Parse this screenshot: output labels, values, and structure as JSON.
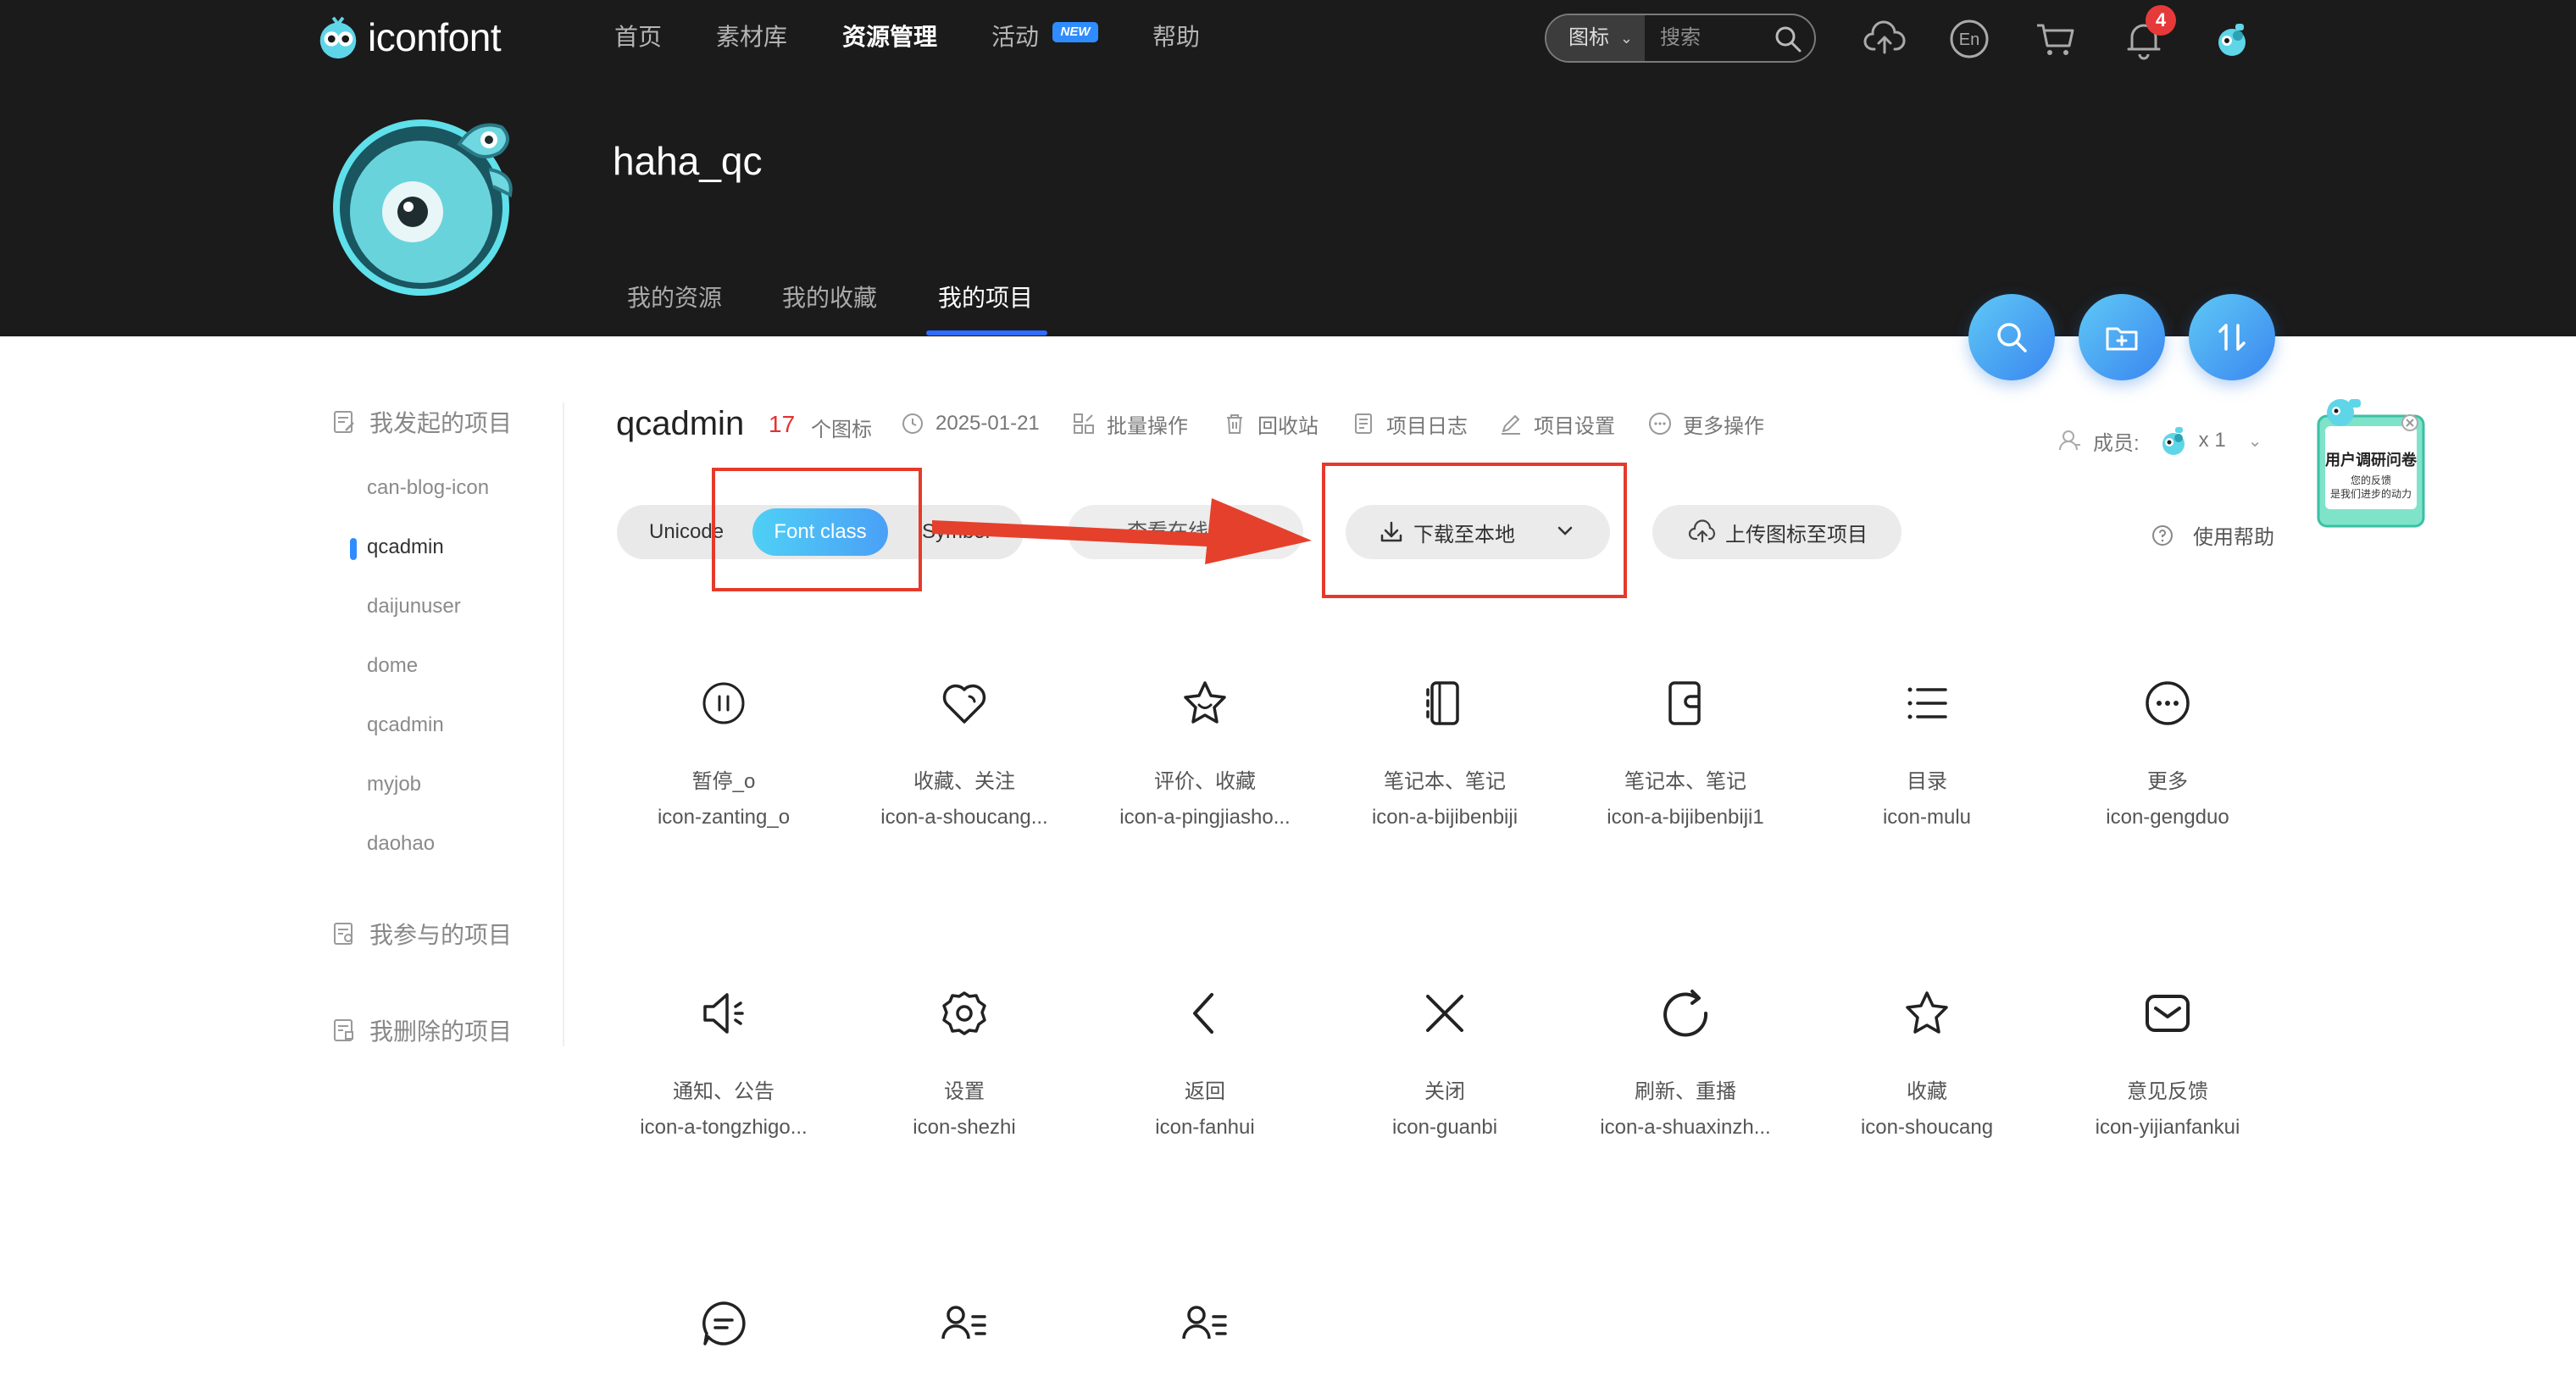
{
  "header": {
    "logo_text": "iconfont",
    "nav": [
      {
        "label": "首页"
      },
      {
        "label": "素材库"
      },
      {
        "label": "资源管理"
      },
      {
        "label": "活动"
      },
      {
        "label": "帮助"
      }
    ],
    "new_badge": "NEW",
    "search": {
      "type_label": "图标",
      "placeholder": "搜索"
    },
    "notification_count": "4"
  },
  "profile": {
    "username": "haha_qc",
    "tabs": [
      {
        "label": "我的资源"
      },
      {
        "label": "我的收藏"
      },
      {
        "label": "我的项目"
      }
    ]
  },
  "sidebar": {
    "group_started": "我发起的项目",
    "projects": [
      "can-blog-icon",
      "qcadmin",
      "daijunuser",
      "dome",
      "qcadmin",
      "myjob",
      "daohao"
    ],
    "group_joined": "我参与的项目",
    "group_deleted": "我删除的项目"
  },
  "project": {
    "title": "qcadmin",
    "icon_count": "17",
    "icon_count_label": "个图标",
    "date": "2025-01-21",
    "actions": [
      "批量操作",
      "回收站",
      "项目日志",
      "项目设置",
      "更多操作"
    ],
    "members_label": "成员:",
    "members_count": "x 1"
  },
  "toolbar": {
    "types": [
      "Unicode",
      "Font class",
      "Symbol"
    ],
    "online_link": "查看在线链接",
    "download": "下载至本地",
    "upload": "上传图标至项目",
    "help": "使用帮助"
  },
  "survey": {
    "title": "用户调研问卷",
    "line1": "您的反馈",
    "line2": "是我们进步的动力"
  },
  "icons": [
    {
      "name": "暂停_o",
      "code": "icon-zanting_o",
      "glyph": "pause-circle-icon"
    },
    {
      "name": "收藏、关注",
      "code": "icon-a-shoucang...",
      "glyph": "heart-icon"
    },
    {
      "name": "评价、收藏",
      "code": "icon-a-pingjiasho...",
      "glyph": "star-smile-icon"
    },
    {
      "name": "笔记本、笔记",
      "code": "icon-a-bijibenbiji",
      "glyph": "notebook-icon"
    },
    {
      "name": "笔记本、笔记",
      "code": "icon-a-bijibenbiji1",
      "glyph": "notebook-alt-icon"
    },
    {
      "name": "目录",
      "code": "icon-mulu",
      "glyph": "list-icon"
    },
    {
      "name": "更多",
      "code": "icon-gengduo",
      "glyph": "more-circle-icon"
    },
    {
      "name": "通知、公告",
      "code": "icon-a-tongzhigo...",
      "glyph": "speaker-icon"
    },
    {
      "name": "设置",
      "code": "icon-shezhi",
      "glyph": "gear-icon"
    },
    {
      "name": "返回",
      "code": "icon-fanhui",
      "glyph": "chevron-left-icon"
    },
    {
      "name": "关闭",
      "code": "icon-guanbi",
      "glyph": "close-icon"
    },
    {
      "name": "刷新、重播",
      "code": "icon-a-shuaxinzh...",
      "glyph": "refresh-icon"
    },
    {
      "name": "收藏",
      "code": "icon-shoucang",
      "glyph": "star-icon"
    },
    {
      "name": "意见反馈",
      "code": "icon-yijianfankui",
      "glyph": "mail-icon"
    },
    {
      "name": "",
      "code": "",
      "glyph": "chat-bubble-icon"
    },
    {
      "name": "",
      "code": "",
      "glyph": "user-list-icon"
    },
    {
      "name": "",
      "code": "",
      "glyph": "user-list-icon"
    }
  ],
  "colors": {
    "header_bg": "#1b1b1b",
    "accent_blue": "#2f8cff",
    "highlight_red": "#e53a2b",
    "count_red": "#e53030"
  }
}
